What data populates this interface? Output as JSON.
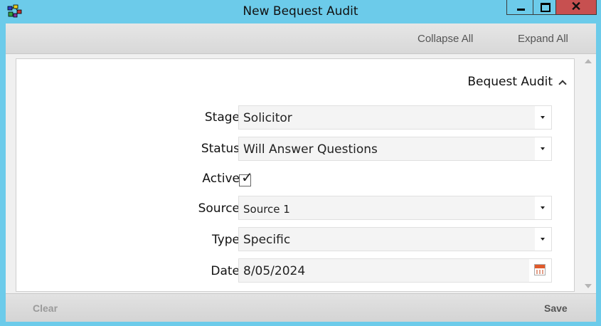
{
  "window": {
    "title": "New Bequest Audit",
    "close_glyph": "✕"
  },
  "toolbar": {
    "collapse_all": "Collapse All",
    "expand_all": "Expand All"
  },
  "section": {
    "title": "Bequest Audit"
  },
  "fields": {
    "stage": {
      "label": "Stage",
      "value": "Solicitor"
    },
    "status": {
      "label": "Status",
      "value": "Will Answer Questions"
    },
    "active": {
      "label": "Active",
      "checked": true,
      "check_glyph": "✓"
    },
    "source": {
      "label": "Source",
      "value": "Source 1"
    },
    "type": {
      "label": "Type",
      "value": "Specific"
    },
    "date": {
      "label": "Date",
      "value": "8/05/2024"
    }
  },
  "footer": {
    "clear": "Clear",
    "save": "Save"
  },
  "icons": {
    "app": "app-icon",
    "minimize": "minimize-icon",
    "maximize": "maximize-icon",
    "close": "close-icon",
    "section_toggle": "chevron-up-icon",
    "dropdown": "dropdown-arrow-icon",
    "calendar": "calendar-icon"
  },
  "colors": {
    "titlebar": "#6ccbea",
    "close_button": "#c75050",
    "calendar_accent": "#e05a2b"
  }
}
